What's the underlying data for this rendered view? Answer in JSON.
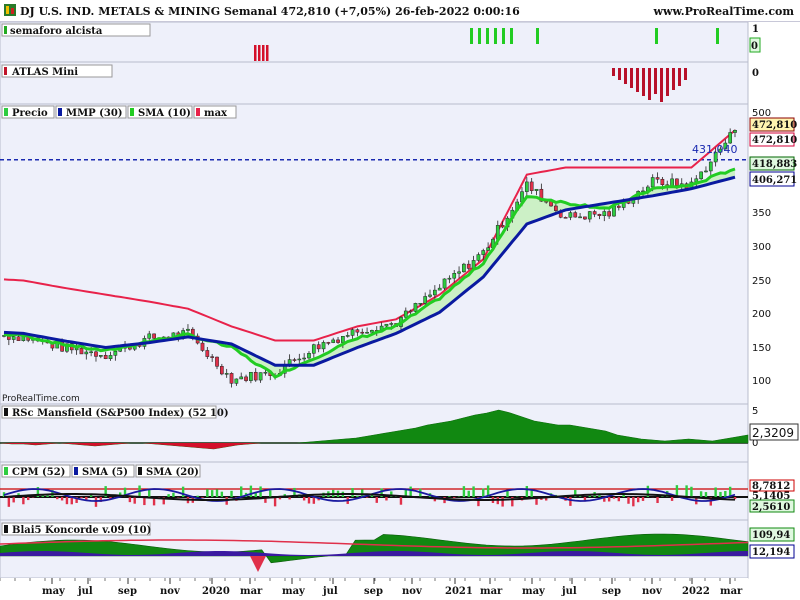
{
  "header": {
    "title": "DJ U.S. IND. METALS & MINING Semanal 472,810 (+7,05%) 26-feb-2022 0:00:16",
    "site": "www.ProRealTime.com"
  },
  "panels": {
    "semaforo": {
      "label": "semaforo alcista",
      "ticks": [
        "1",
        "0"
      ]
    },
    "atlas": {
      "label": "ATLAS Mini",
      "ticks": [
        "0"
      ]
    },
    "price": {
      "legend": [
        "Precio",
        "MMP (30)",
        "SMA (10)",
        "max"
      ],
      "watermark": "ProRealTime.com",
      "ticks": [
        "500",
        "350",
        "300",
        "250",
        "200",
        "150",
        "100"
      ],
      "hline_label": "431,040",
      "badges": [
        {
          "text": "472,810",
          "color": "#8b0000",
          "bg": "#fff4b0"
        },
        {
          "text": "472,810",
          "color": "#d4003a",
          "bg": "#ffffff"
        },
        {
          "text": "418,883",
          "color": "#006400",
          "bg": "#e0f8e0"
        },
        {
          "text": "406,271",
          "color": "#000090",
          "bg": "#ffffff"
        }
      ]
    },
    "rsc": {
      "label": "RSc Mansfield (S&P500 Index) (52 10)",
      "ticks": [
        "5",
        "0"
      ],
      "badge": "2,3209"
    },
    "cpm": {
      "labels": [
        "CPM (52)",
        "SMA (5)",
        "SMA (20)"
      ],
      "badges": [
        "8,7812",
        "5,1405",
        "2,5610"
      ]
    },
    "blai": {
      "label": "Blai5 Koncorde v.09 (10)",
      "badges": [
        "109,94",
        "12,194"
      ]
    }
  },
  "x_axis": {
    "labels": [
      "may",
      "jul",
      "sep",
      "nov",
      "2020",
      "mar",
      "may",
      "jul",
      "sep",
      "nov",
      "2021",
      "mar",
      "may",
      "jul",
      "sep",
      "nov",
      "2022",
      "mar"
    ]
  },
  "colors": {
    "candle_up": "#2ecc40",
    "candle_down": "#e0304a",
    "mmp": "#0a1aa0",
    "sma": "#22cc22",
    "max": "#e8224a",
    "fill": "#c8f0c0",
    "panel_bg": "#eef0fa"
  },
  "chart_data": {
    "type": "line",
    "title": "DJ U.S. IND. METALS & MINING Semanal",
    "x": [
      "may 2019",
      "jul 2019",
      "sep 2019",
      "nov 2019",
      "ene 2020",
      "mar 2020",
      "may 2020",
      "jul 2020",
      "sep 2020",
      "nov 2020",
      "ene 2021",
      "mar 2021",
      "may 2021",
      "jul 2021",
      "sep 2021",
      "nov 2021",
      "ene 2022",
      "feb 2022"
    ],
    "series": [
      {
        "name": "Precio",
        "values": [
          180,
          165,
          155,
          178,
          185,
          120,
          130,
          165,
          190,
          200,
          250,
          300,
          395,
          350,
          355,
          400,
          395,
          472.81
        ]
      },
      {
        "name": "MMP (30)",
        "values": [
          185,
          175,
          165,
          172,
          180,
          170,
          140,
          140,
          165,
          185,
          215,
          265,
          340,
          360,
          370,
          380,
          390,
          406.27
        ]
      },
      {
        "name": "SMA (10)",
        "values": [
          182,
          170,
          160,
          174,
          183,
          165,
          125,
          150,
          178,
          195,
          235,
          285,
          380,
          370,
          362,
          390,
          395,
          418.88
        ]
      },
      {
        "name": "max",
        "values": [
          260,
          250,
          240,
          230,
          220,
          195,
          175,
          175,
          195,
          205,
          240,
          290,
          410,
          420,
          420,
          420,
          420,
          472.81
        ]
      }
    ],
    "ylim": [
      85,
      510
    ],
    "horizontal_line": 431.04
  }
}
